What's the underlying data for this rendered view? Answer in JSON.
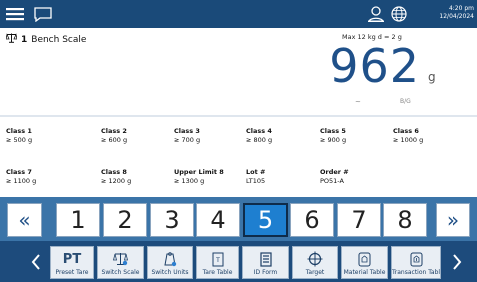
{
  "topbar": {
    "time": "4:20 pm",
    "date": "12/04/2024",
    "icons": [
      "menu-icon",
      "chat-icon",
      "user-icon",
      "globe-icon"
    ]
  },
  "scale": {
    "number": "1",
    "name": "Bench Scale",
    "max_info": "Max 12 kg d = 2 g",
    "weight": "962",
    "unit": "g",
    "motion_indicator": "~",
    "mode": "B/G",
    "accent_color": "#1f5089"
  },
  "classes": [
    {
      "label": "Class 1",
      "value": "≥ 500 g"
    },
    {
      "label": "Class 2",
      "value": "≥ 600 g"
    },
    {
      "label": "Class 3",
      "value": "≥ 700 g"
    },
    {
      "label": "Class 4",
      "value": "≥ 800 g"
    },
    {
      "label": "Class 5",
      "value": "≥ 900 g"
    },
    {
      "label": "Class 6",
      "value": "≥ 1000 g"
    },
    {
      "label": "Class 7",
      "value": "≥ 1100 g"
    },
    {
      "label": "Class 8",
      "value": "≥ 1200 g"
    },
    {
      "label": "Upper Limit 8",
      "value": "≥ 1300 g"
    },
    {
      "label": "Lot #",
      "value": "LT105"
    },
    {
      "label": "Order  #",
      "value": "PO51-A"
    }
  ],
  "number_strip": {
    "prev": "«",
    "next": "»",
    "buttons": [
      "1",
      "2",
      "3",
      "4",
      "5",
      "6",
      "7",
      "8"
    ],
    "selected": "5",
    "selected_color": "#1e7fd0"
  },
  "toolbar": {
    "buttons": [
      {
        "label": "Preset Tare",
        "icon": "preset-tare-icon",
        "glyph": "PT"
      },
      {
        "label": "Switch Scale",
        "icon": "switch-scale-icon"
      },
      {
        "label": "Switch Units",
        "icon": "switch-units-icon"
      },
      {
        "label": "Tare Table",
        "icon": "tare-table-icon"
      },
      {
        "label": "ID Form",
        "icon": "id-form-icon"
      },
      {
        "label": "Target",
        "icon": "target-icon"
      },
      {
        "label": "Material Table",
        "icon": "material-table-icon"
      },
      {
        "label": "Transaction Table",
        "icon": "transaction-table-icon"
      }
    ]
  }
}
